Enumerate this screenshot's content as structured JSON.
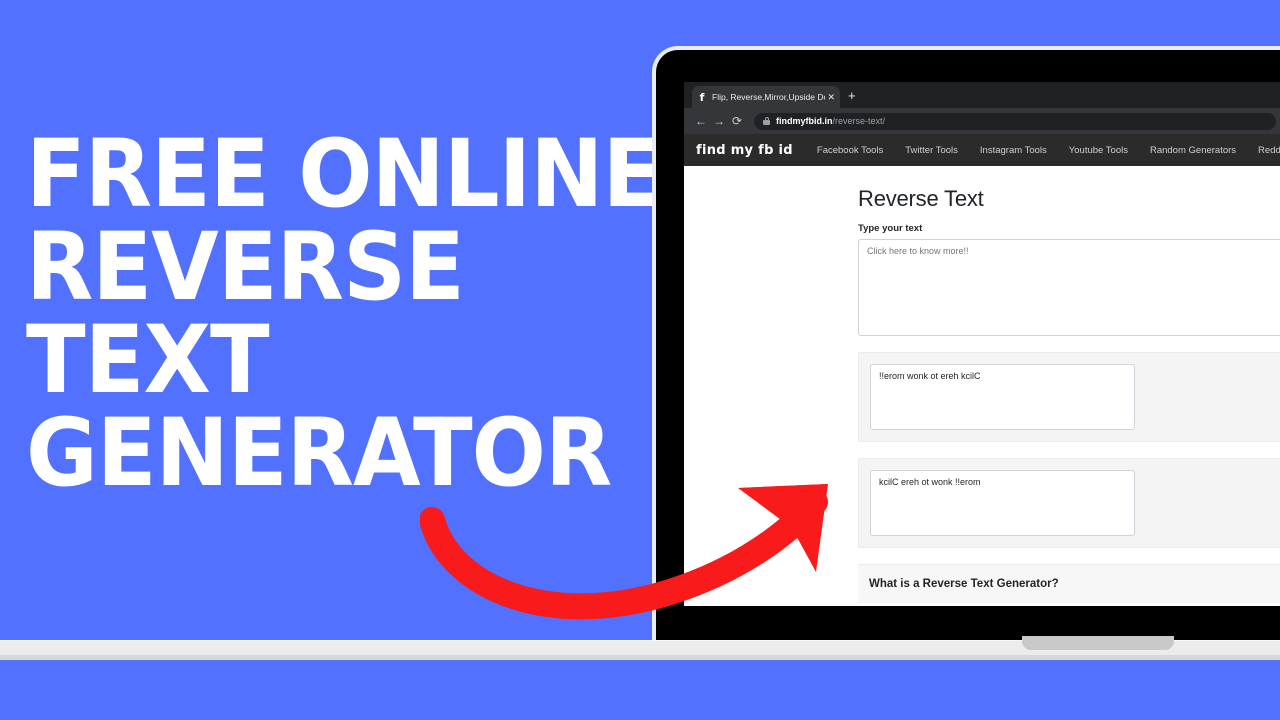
{
  "poster": {
    "background_color": "#5271ff",
    "headline_lines": [
      "FREE ONLINE",
      "REVERSE",
      "TEXT",
      "GENERATOR"
    ],
    "arrow_color": "#f91b1b"
  },
  "browser": {
    "tab": {
      "favicon": "f-logo-icon",
      "title": "Flip, Reverse,Mirror,Upside Down",
      "close_label": "✕"
    },
    "new_tab_label": "+",
    "toolbar": {
      "back_label": "←",
      "forward_label": "→",
      "reload_label": "⟳",
      "lock_icon": "lock-icon",
      "url_host": "findmyfbid.in",
      "url_path": "/reverse-text/"
    }
  },
  "site": {
    "brand": "find my fb id",
    "nav": [
      {
        "label": "Facebook Tools"
      },
      {
        "label": "Twitter Tools"
      },
      {
        "label": "Instagram Tools"
      },
      {
        "label": "Youtube Tools"
      },
      {
        "label": "Random Generators"
      },
      {
        "label": "Reddit Tools"
      }
    ]
  },
  "page": {
    "heading": "Reverse Text",
    "input_label": "Type your text",
    "input_value": "Click here to know more!!",
    "input_placeholder": "Click here to know more!!",
    "results": [
      {
        "value": "!!erom wonk ot ereh kcilC"
      },
      {
        "value": "kcilC ereh ot wonk !!erom"
      }
    ],
    "faq_heading": "What is a Reverse Text Generator?"
  }
}
